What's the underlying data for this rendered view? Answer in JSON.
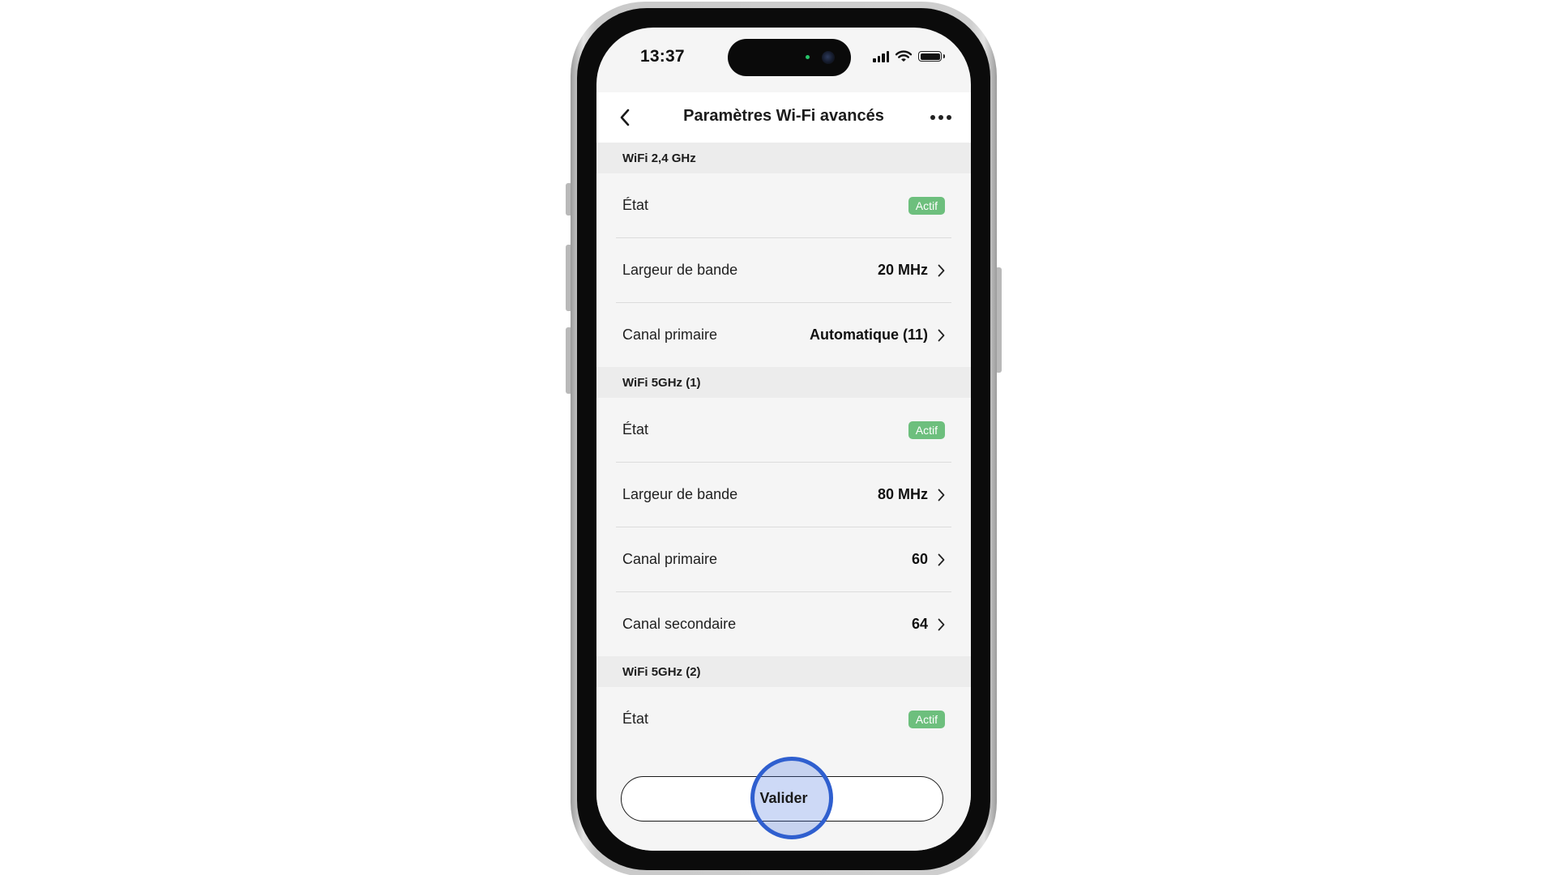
{
  "status_bar": {
    "time": "13:37",
    "icons": [
      "cellular-signal-icon",
      "wifi-icon",
      "battery-icon"
    ]
  },
  "header": {
    "title": "Paramètres Wi-Fi avancés",
    "back_icon": "chevron-left-icon",
    "more_icon": "more-horizontal-icon"
  },
  "sections": [
    {
      "title": "WiFi 2,4 GHz",
      "rows": [
        {
          "label": "État",
          "badge": "Actif"
        },
        {
          "label": "Largeur de bande",
          "value": "20 MHz"
        },
        {
          "label": "Canal primaire",
          "value": "Automatique (11)"
        }
      ]
    },
    {
      "title": "WiFi 5GHz (1)",
      "rows": [
        {
          "label": "État",
          "badge": "Actif"
        },
        {
          "label": "Largeur de bande",
          "value": "80 MHz"
        },
        {
          "label": "Canal primaire",
          "value": "60"
        },
        {
          "label": "Canal secondaire",
          "value": "64"
        }
      ]
    },
    {
      "title": "WiFi 5GHz (2)",
      "rows": [
        {
          "label": "État",
          "badge": "Actif"
        }
      ]
    }
  ],
  "footer": {
    "validate_label": "Valider"
  },
  "colors": {
    "badge_green": "#6dbf7d",
    "section_bg": "#ececec",
    "screen_bg": "#f5f5f5",
    "tap_indicator": "#2f5fcf"
  }
}
